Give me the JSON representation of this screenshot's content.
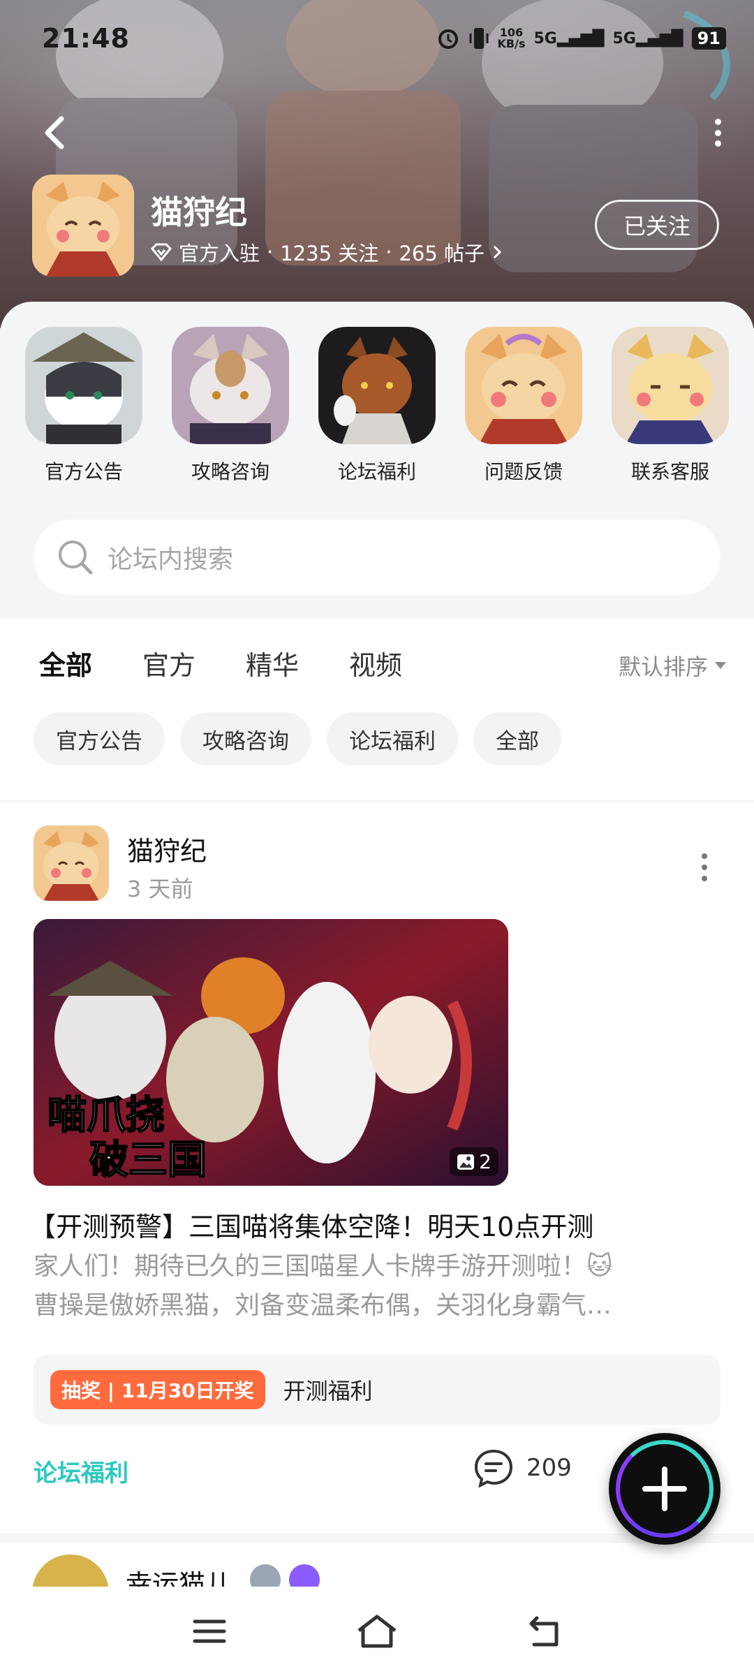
{
  "status_bar": {
    "time": "21:48",
    "net_speed_top": "106",
    "net_speed_bottom": "KB/s",
    "signal_1": "5G",
    "signal_2": "5G",
    "battery": "91"
  },
  "header": {
    "title": "猫狩纪",
    "meta_official": "官方入驻",
    "meta_followers": "1235 关注",
    "meta_posts": "265 帖子",
    "follow_label": "已关注"
  },
  "quick_links": [
    {
      "label": "官方公告"
    },
    {
      "label": "攻略咨询"
    },
    {
      "label": "论坛福利"
    },
    {
      "label": "问题反馈"
    },
    {
      "label": "联系客服"
    }
  ],
  "search": {
    "placeholder": "论坛内搜索"
  },
  "tabs": [
    {
      "label": "全部",
      "active": true
    },
    {
      "label": "官方"
    },
    {
      "label": "精华"
    },
    {
      "label": "视频"
    }
  ],
  "sort_label": "默认排序",
  "chips": [
    "官方公告",
    "攻略咨询",
    "论坛福利",
    "全部"
  ],
  "post": {
    "author": "猫狩纪",
    "time": "3 天前",
    "image_count": "2",
    "image_caption_line1": "喵爪挠",
    "image_caption_line2": "破三国",
    "title": "【开测预警】三国喵将集体空降！明天10点开测",
    "body_line1": "家人们！期待已久的三国喵星人卡牌手游开测啦！🐱",
    "body_line2": "曹操是傲娇黑猫，刘备变温柔布偶，关羽化身霸气…",
    "lottery_badge": "抽奖 | 11月30日开奖",
    "lottery_text": "开测福利",
    "tag": "论坛福利",
    "comments": "209"
  },
  "next_post": {
    "author": "幸运猫儿"
  },
  "colors": {
    "accent": "#2bd0c5",
    "lottery": "#ff6b3d",
    "tag": "#2bc9bf"
  }
}
